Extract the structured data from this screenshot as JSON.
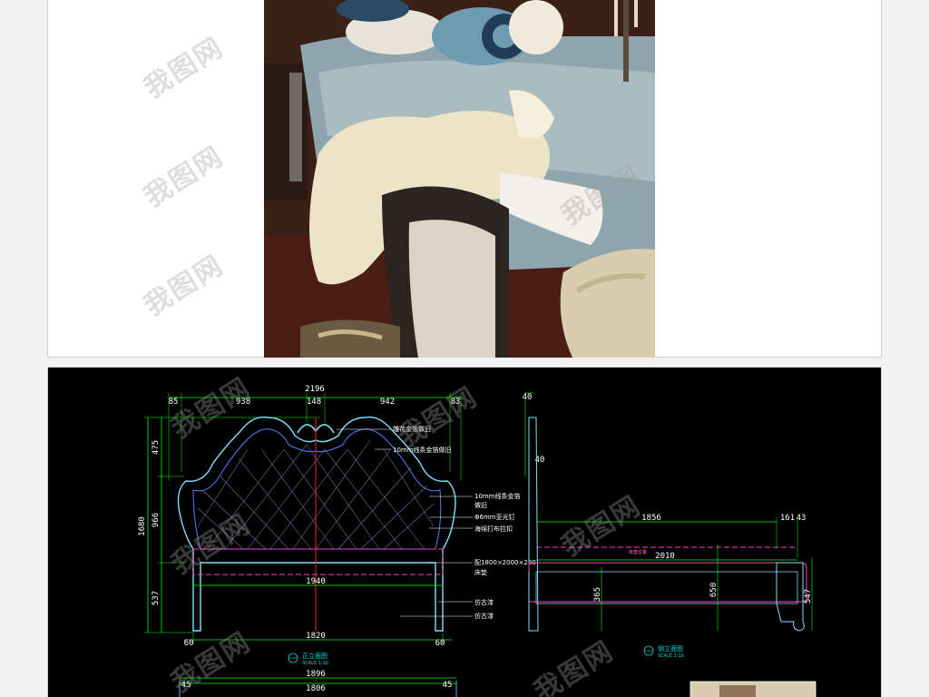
{
  "watermark": {
    "text": "我图网"
  },
  "photo": {
    "subject": "bedroom-photo"
  },
  "front_elevation": {
    "dims_top": {
      "total": "2196",
      "left_end": "85",
      "left": "938",
      "center": "148",
      "right": "942",
      "right_end": "83"
    },
    "dims_left": {
      "total": "1680",
      "top": "475",
      "middle": "966",
      "bottom": "537"
    },
    "dim_seat_width": "1940",
    "dims_bottom": {
      "inner": "1820",
      "left": "60",
      "right": "60"
    },
    "dims_bottom2": {
      "outer": "1896",
      "inner": "1806",
      "left": "45",
      "right": "45"
    },
    "notes": [
      "雕花金箔做旧",
      "10mm线条金箔做旧",
      "10mm线条金箔",
      "做旧",
      "Φ6mm亚光钉",
      "海绵打布拉扣",
      "配1800×2000×200",
      "床垫",
      "仿古漆",
      "仿古漆"
    ],
    "title": "正立面图",
    "scale": "SCALE 1:10"
  },
  "side_elevation": {
    "dims_top_left": "40",
    "dims_mid_left": "40",
    "dim_length": "1856",
    "dim_end": "161",
    "dim_end2": "43",
    "dim_total": "2010",
    "mattress_label": "床垫位置",
    "dim_rail": "365",
    "dim_head": "650",
    "dim_foot": "547",
    "title": "侧立面图",
    "scale": "SCALE 1:10"
  }
}
